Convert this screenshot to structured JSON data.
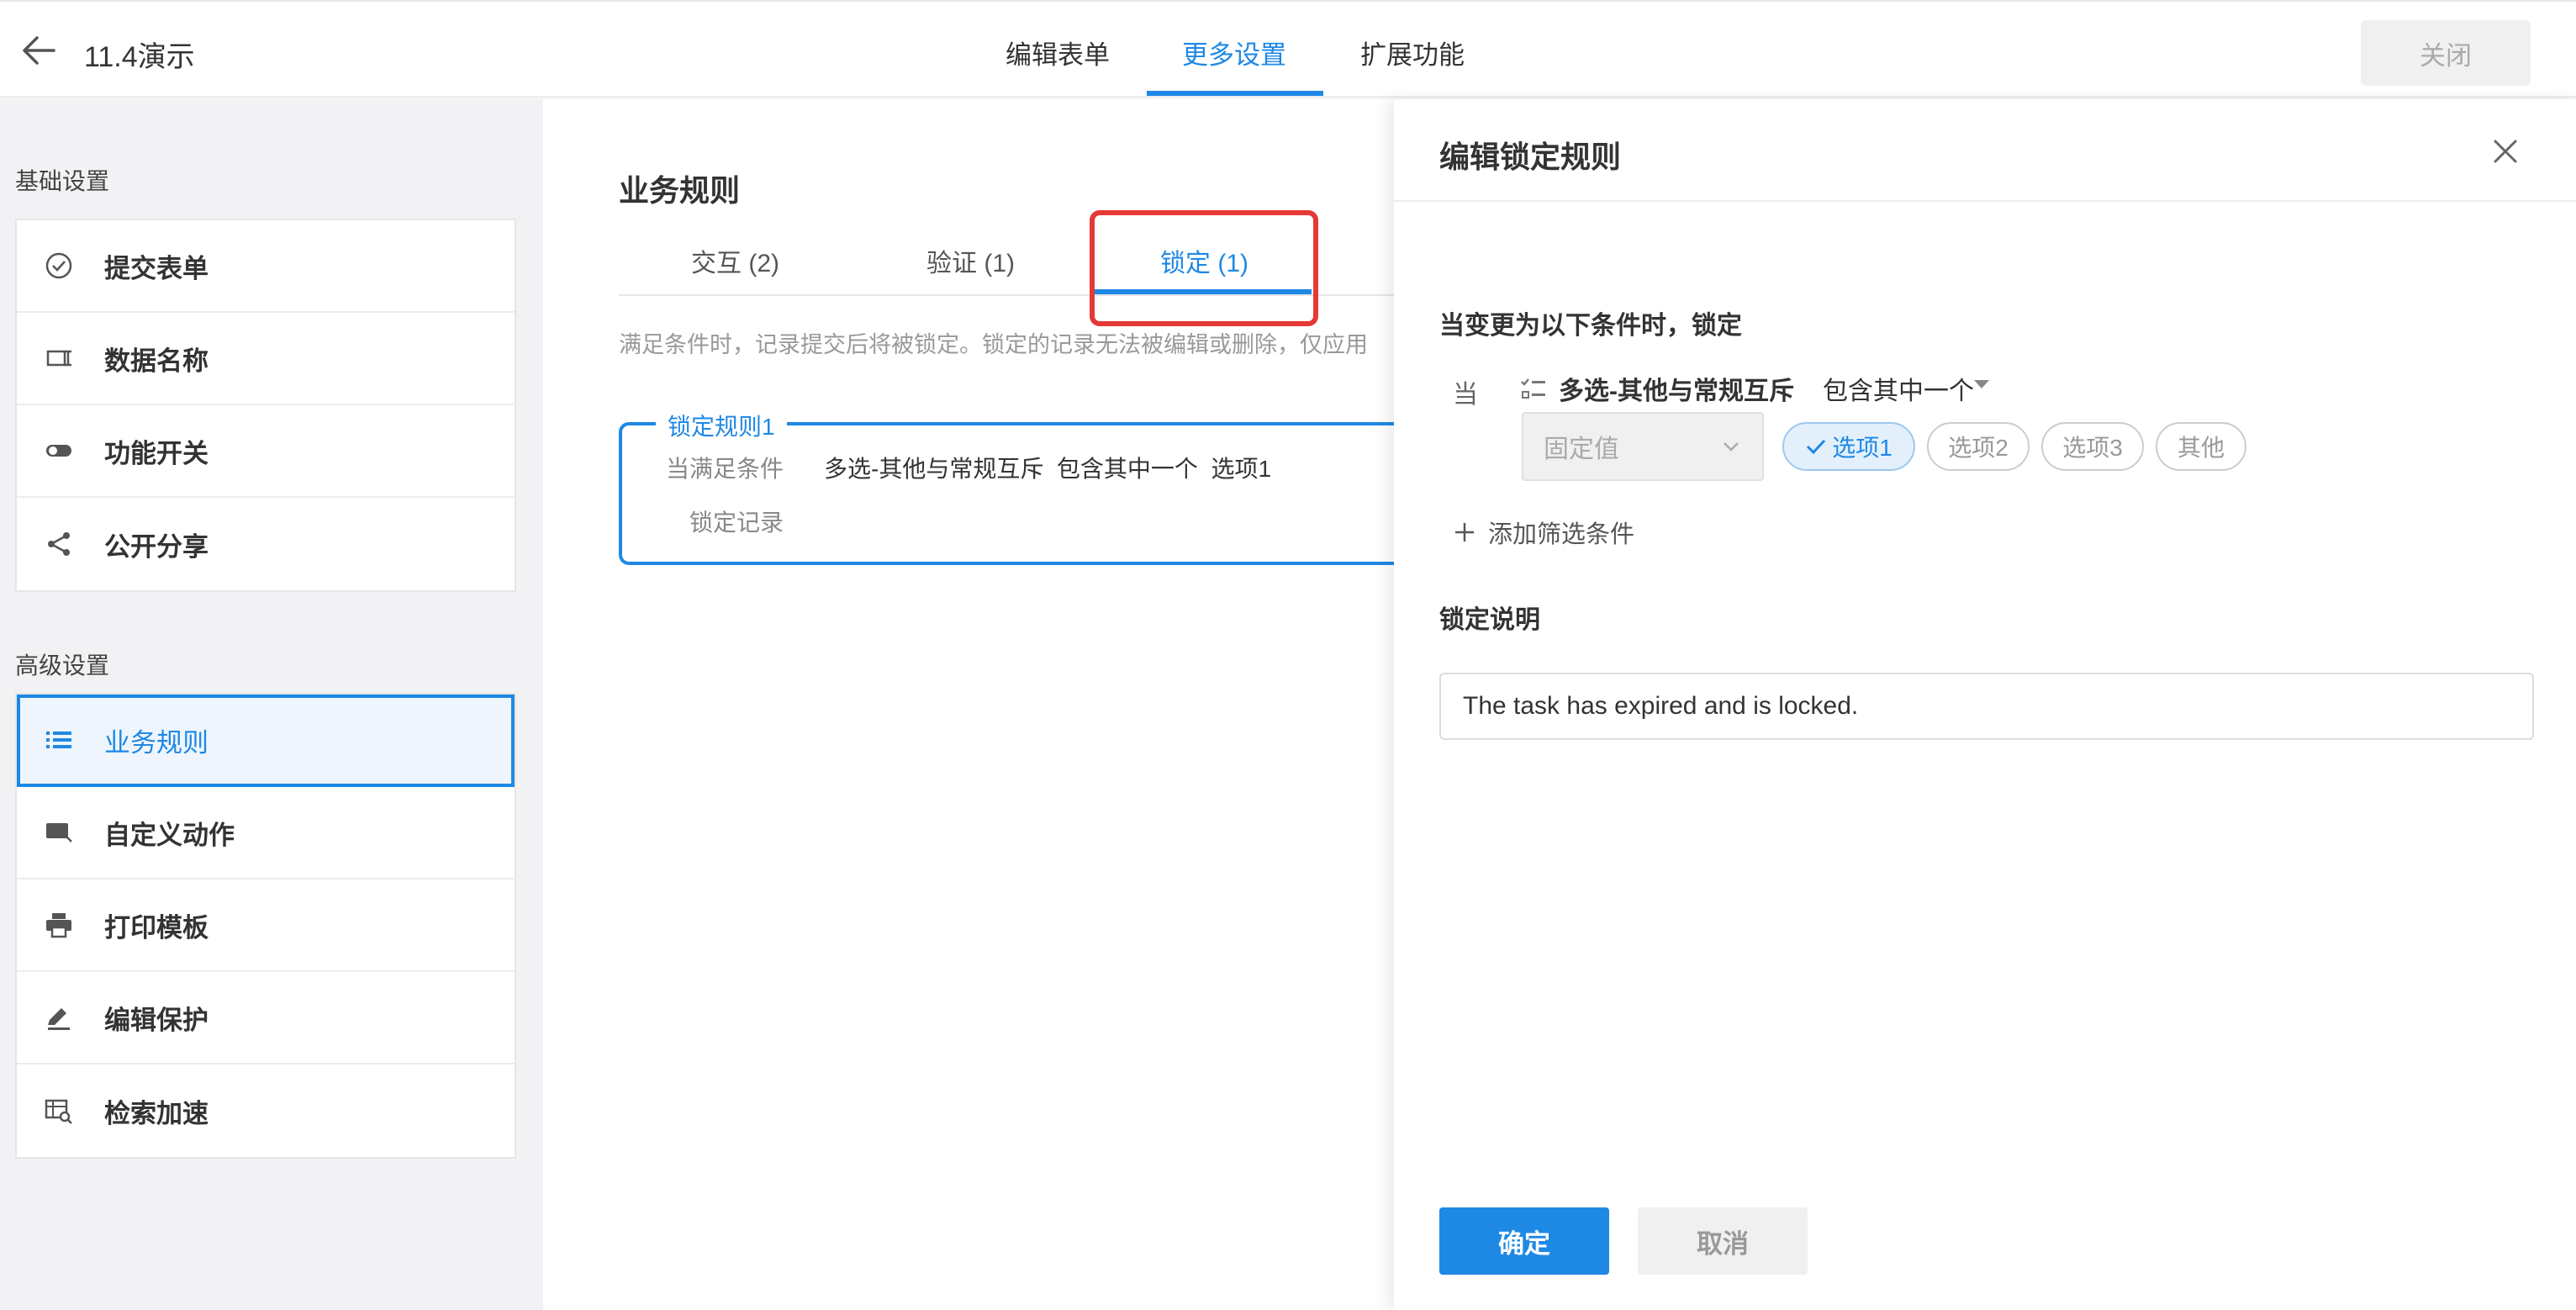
{
  "header": {
    "title": "11.4演示",
    "tabs": [
      {
        "label": "编辑表单"
      },
      {
        "label": "更多设置"
      },
      {
        "label": "扩展功能"
      }
    ],
    "active_tab": "更多设置",
    "close_label": "关闭"
  },
  "sidebar": {
    "basic_title": "基础设置",
    "basic_items": [
      {
        "label": "提交表单",
        "icon": "check-circle-icon"
      },
      {
        "label": "数据名称",
        "icon": "label-icon"
      },
      {
        "label": "功能开关",
        "icon": "toggle-icon"
      },
      {
        "label": "公开分享",
        "icon": "share-icon"
      }
    ],
    "advanced_title": "高级设置",
    "advanced_items": [
      {
        "label": "业务规则",
        "icon": "list-icon",
        "active": true
      },
      {
        "label": "自定义动作",
        "icon": "custom-action-icon"
      },
      {
        "label": "打印模板",
        "icon": "printer-icon"
      },
      {
        "label": "编辑保护",
        "icon": "pen-icon"
      },
      {
        "label": "检索加速",
        "icon": "search-speed-icon"
      }
    ]
  },
  "center": {
    "title": "业务规则",
    "tabs": [
      {
        "label": "交互 (2)"
      },
      {
        "label": "验证 (1)"
      },
      {
        "label": "锁定 (1)"
      }
    ],
    "active_tab": "锁定 (1)",
    "description": "满足条件时，记录提交后将被锁定。锁定的记录无法被编辑或删除，仅应用",
    "rule": {
      "name": "锁定规则1",
      "condition_label": "当满足条件",
      "condition_value": "多选-其他与常规互斥  包含其中一个  选项1",
      "action_label": "锁定记录"
    }
  },
  "drawer": {
    "title": "编辑锁定规则",
    "condition_heading": "当变更为以下条件时，锁定",
    "when_label": "当",
    "field_name": "多选-其他与常规互斥",
    "operator": "包含其中一个",
    "value_type": "固定值",
    "options": [
      {
        "label": "选项1",
        "selected": true
      },
      {
        "label": "选项2",
        "selected": false
      },
      {
        "label": "选项3",
        "selected": false
      },
      {
        "label": "其他",
        "selected": false
      }
    ],
    "add_filter_label": "添加筛选条件",
    "lock_desc_title": "锁定说明",
    "lock_desc_value": "The task has expired and is locked.",
    "confirm_label": "确定",
    "cancel_label": "取消"
  },
  "colors": {
    "accent": "#1e88e5",
    "highlight": "#e53935"
  }
}
